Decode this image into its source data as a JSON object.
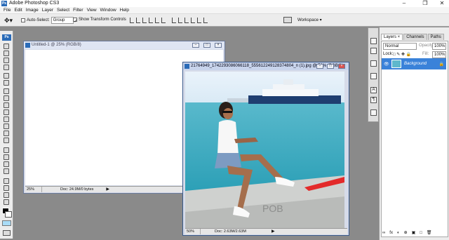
{
  "app": {
    "title": "Adobe Photoshop CS3",
    "logo": "Ps"
  },
  "window_controls": {
    "minimize": "–",
    "maximize": "❐",
    "close": "✕"
  },
  "menu": [
    "File",
    "Edit",
    "Image",
    "Layer",
    "Select",
    "Filter",
    "View",
    "Window",
    "Help"
  ],
  "options": {
    "auto_select_label": "Auto-Select:",
    "auto_select_value": "Group",
    "transform_label": "Show Transform Controls",
    "workspace_label": "Workspace ▾"
  },
  "doc1": {
    "title": "Untitled-1 @ 25% (RGB/8)",
    "zoom": "25%",
    "info": "Doc: 24.9M/0 bytes"
  },
  "doc2": {
    "title": "21764949_1742293086066118_5556122491283748​04_n (1).jpg @ 50% (RGB/8)",
    "zoom": "50%",
    "info": "Doc: 2.63M/2.63M"
  },
  "layers_panel": {
    "tabs": [
      "Layers ×",
      "Channels",
      "Paths"
    ],
    "blend_mode": "Normal",
    "opacity_label": "Opacity:",
    "opacity_value": "100%",
    "lock_label": "Lock:",
    "fill_label": "Fill:",
    "fill_value": "100%",
    "layer_name": "Background",
    "bottom_icons": [
      "∞",
      "fx",
      "◐",
      "⊕",
      "▣",
      "□",
      "🗑"
    ]
  },
  "colors": {
    "accent": "#3a82d9",
    "selected_layer": "#3a82d9"
  }
}
